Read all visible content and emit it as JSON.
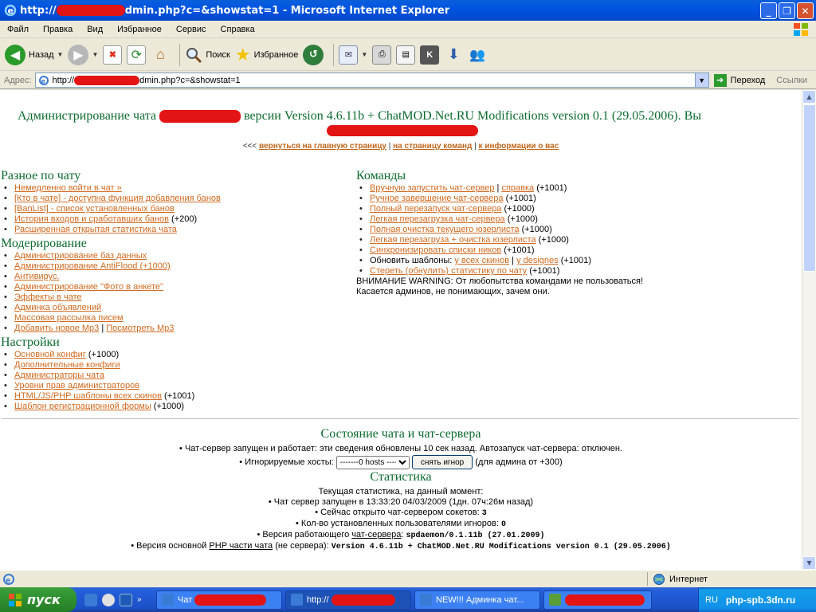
{
  "window": {
    "title_prefix": "http://",
    "title_suffix": "dmin.php?c=&showstat=1 - Microsoft Internet Explorer"
  },
  "menu": [
    "Файл",
    "Правка",
    "Вид",
    "Избранное",
    "Сервис",
    "Справка"
  ],
  "toolbar": {
    "back_label": "Назад",
    "search_label": "Поиск",
    "favorites_label": "Избранное"
  },
  "address": {
    "label": "Адрес:",
    "url_prefix": "http://",
    "url_suffix": "dmin.php?c=&showstat=1",
    "go_label": "Переход",
    "links_label": "Ссылки"
  },
  "page": {
    "title_left": "Администрирование чата",
    "title_right": "версии Version 4.6.11b + ChatMOD.Net.RU Modifications version 0.1 (29.05.2006). Вы",
    "nav_prefix": "<<<",
    "nav_links": [
      "вернуться на главную страницу",
      "на страницу команд",
      "к информации о вас"
    ],
    "nav_sep": "|"
  },
  "left": {
    "s1_title": "Разное по чату",
    "s1_items": [
      {
        "link": "Немедленно войти в чат »",
        "suffix": ""
      },
      {
        "link": "[Кто в чате] - доступна функция добавления банов",
        "suffix": ""
      },
      {
        "link": "[BanList] - список установленных банов",
        "suffix": ""
      },
      {
        "link": "История входов и сработавших банов",
        "suffix": " (+200)"
      },
      {
        "link": "Расширенная открытая статистика чата",
        "suffix": ""
      }
    ],
    "s2_title": "Модерирование",
    "s2_items": [
      {
        "link": "Администрирование баз данных",
        "suffix": ""
      },
      {
        "link": "Администрирование AntiFlood (+1000)",
        "suffix": ""
      },
      {
        "link": "Антивирус.",
        "suffix": ""
      },
      {
        "link": "Администрирование \"Фото в анкете\"",
        "suffix": ""
      },
      {
        "link": "Эффекты в чате",
        "suffix": ""
      },
      {
        "link": "Админка объявлений",
        "suffix": ""
      },
      {
        "link": "Массовая рассылка писем",
        "suffix": ""
      }
    ],
    "s2_mp3": {
      "link1": "Добавить новое Mp3",
      "sep": " | ",
      "link2": "Посмотреть Mp3"
    },
    "s3_title": "Настройки",
    "s3_items": [
      {
        "link": "Основной конфиг",
        "suffix": " (+1000)"
      },
      {
        "link": "Дополнительные конфиги",
        "suffix": ""
      },
      {
        "link": "Администраторы чата",
        "suffix": ""
      },
      {
        "link": "Уровни прав администраторов",
        "suffix": ""
      },
      {
        "link": "HTML/JS/PHP шаблоны всех скинов",
        "suffix": " (+1001)"
      },
      {
        "link": "Шаблон регистрационной формы",
        "suffix": " (+1000)"
      }
    ]
  },
  "right": {
    "title": "Команды",
    "items": [
      {
        "link": "Вручную запустить чат-сервер",
        "sep": " | ",
        "link2": "справка",
        "suffix": " (+1001)"
      },
      {
        "link": "Ручное завершение чат-сервера",
        "suffix": " (+1001)"
      },
      {
        "link": "Полный перезапуск чат-сервера",
        "suffix": " (+1000)"
      },
      {
        "link": "Легкая перезагрузка чат-сервера",
        "suffix": " (+1000)"
      },
      {
        "link": "Полная очистка текущего юзерлиста",
        "suffix": " (+1000)"
      },
      {
        "link": "Легкая перезагруза + очистка юзерлиста",
        "suffix": " (+1000)"
      },
      {
        "link": "Синхронизировать списки ников",
        "suffix": " (+1001)"
      },
      {
        "prefix": "Обновить шаблоны: ",
        "link": "у всех скинов",
        "sep": " | ",
        "link2": "у designes",
        "suffix": " (+1001)"
      },
      {
        "link": "Стереть (обнулить) статистику по чату",
        "suffix": " (+1001)"
      }
    ],
    "warning1": "ВНИМАНИЕ WARNING: От любопытства командами не пользоваться!",
    "warning2": "Касается админов, не понимающих, зачем они."
  },
  "status": {
    "title": "Состояние чата и чат-сервера",
    "line1": "Чат-сервер запущен и работает: эти сведения обновлены 10 сек назад. Автозапуск чат-сервера: отключен.",
    "ignored_label": "Игнорируемые хосты:",
    "hosts_option": "-------0 hosts -------",
    "unban_btn": "снять игнор",
    "admin_note": "(для админа от +300)"
  },
  "stats": {
    "title": "Статистика",
    "current": "Текущая статистика, на данный момент:",
    "started": "Чат сервер запущен в 13:33:20 04/03/2009 (1дн. 07ч:26м назад)",
    "sockets_label": "Сейчас открыто чат-сервером сокетов:",
    "sockets_value": "3",
    "ignores_label": "Кол-во установленных пользователями игноров:",
    "ignores_value": "0",
    "server_label": "Версия работающего",
    "server_link": "чат-сервера",
    "server_colon": ":",
    "server_value": "spdaemon/0.1.11b (27.01.2009)",
    "php_label": "Версия основной",
    "php_link": "PHP части чата",
    "php_mid": "(не сервера):",
    "php_value": "Version 4.6.11b + ChatMOD.Net.RU Modifications version 0.1 (29.05.2006)"
  },
  "statusbar": {
    "zone": "Интернет"
  },
  "taskbar": {
    "start": "пуск",
    "tasks": [
      "Чат",
      "http://",
      "NEW!!! Админка чат...",
      ""
    ],
    "lang": "RU",
    "site": "php-spb.3dn.ru"
  }
}
